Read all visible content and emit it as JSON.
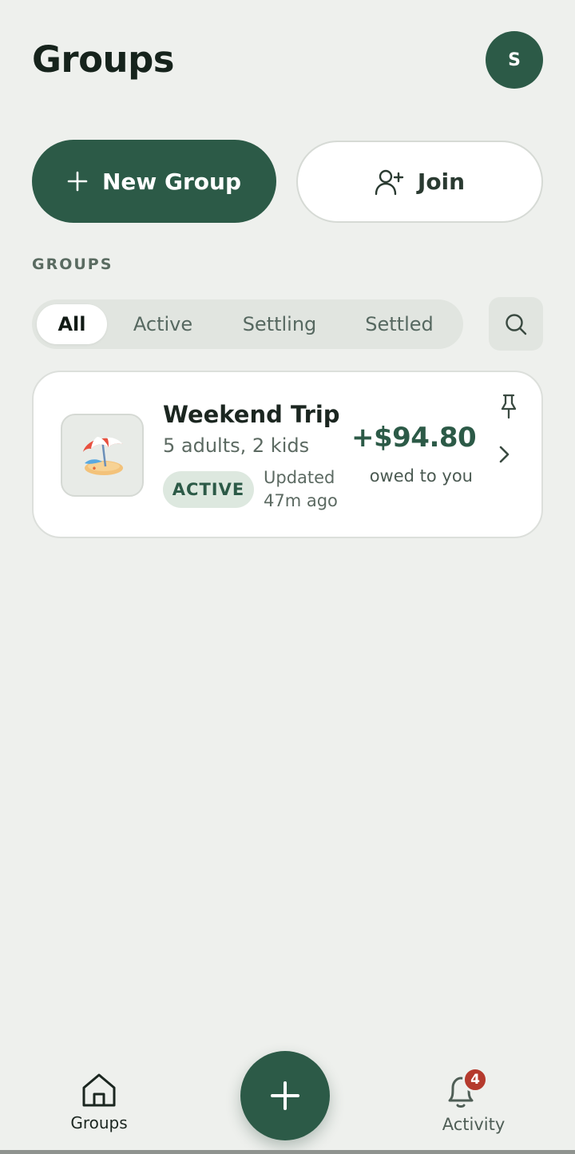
{
  "header": {
    "title": "Groups",
    "avatar_initial": "S"
  },
  "actions": {
    "new_group_label": "New Group",
    "join_label": "Join"
  },
  "section": {
    "heading": "GROUPS"
  },
  "filters": {
    "tabs": [
      "All",
      "Active",
      "Settling",
      "Settled"
    ],
    "selected": "All"
  },
  "groups": [
    {
      "name": "Weekend Trip",
      "members": "5 adults, 2 kids",
      "status": "ACTIVE",
      "updated": "Updated 47m ago",
      "amount": "+$94.80",
      "amount_caption": "owed to you",
      "icon": "beach-umbrella-icon"
    }
  ],
  "bottom_nav": {
    "groups_label": "Groups",
    "activity_label": "Activity",
    "activity_badge": "4"
  },
  "colors": {
    "brand": "#2c5a47",
    "background": "#eef0ed",
    "badge_red": "#b53a2d"
  }
}
